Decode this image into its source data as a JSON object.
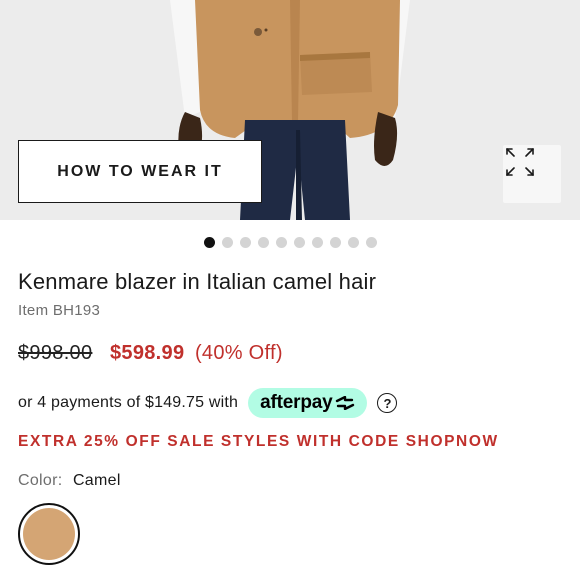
{
  "hero": {
    "how_to_wear_label": "HOW TO WEAR IT",
    "expand_icon": "expand-icon",
    "slide_count": 10,
    "active_slide": 1
  },
  "product": {
    "title": "Kenmare blazer in Italian camel hair",
    "item_number": "Item BH193",
    "original_price": "$998.00",
    "sale_price": "$598.99",
    "discount": "(40% Off)"
  },
  "afterpay": {
    "text": "or 4 payments of $149.75 with",
    "brand": "afterpay",
    "help_icon": "?"
  },
  "promo": {
    "text": "EXTRA 25% OFF SALE STYLES WITH CODE SHOPNOW"
  },
  "color": {
    "label": "Color:",
    "value": "Camel",
    "swatch_hex": "#d4a574"
  },
  "colors": {
    "sale_red": "#c0302c",
    "afterpay_mint": "#b2fce4"
  }
}
